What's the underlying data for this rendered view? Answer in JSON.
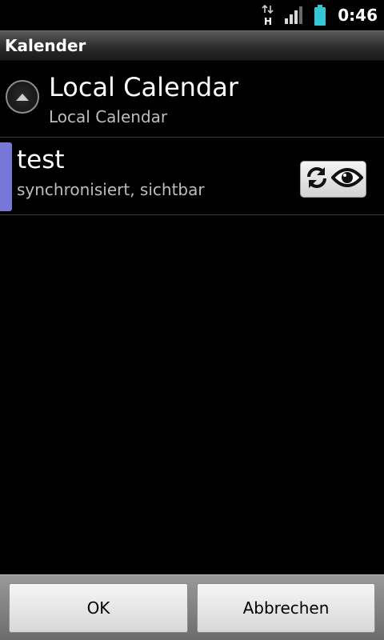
{
  "status_bar": {
    "network_type": "H",
    "time": "0:46",
    "icons": [
      "data-transfer-icon",
      "signal-icon",
      "battery-icon"
    ]
  },
  "title_bar": {
    "title": "Kalender"
  },
  "group": {
    "title": "Local Calendar",
    "subtitle": "Local Calendar",
    "icon": "collapse-up-icon"
  },
  "calendars": [
    {
      "name": "test",
      "status": "synchronisiert, sichtbar",
      "color": "#7777d8",
      "icons": [
        "sync-icon",
        "visible-eye-icon"
      ]
    }
  ],
  "buttons": {
    "ok_label": "OK",
    "cancel_label": "Abbrechen"
  }
}
